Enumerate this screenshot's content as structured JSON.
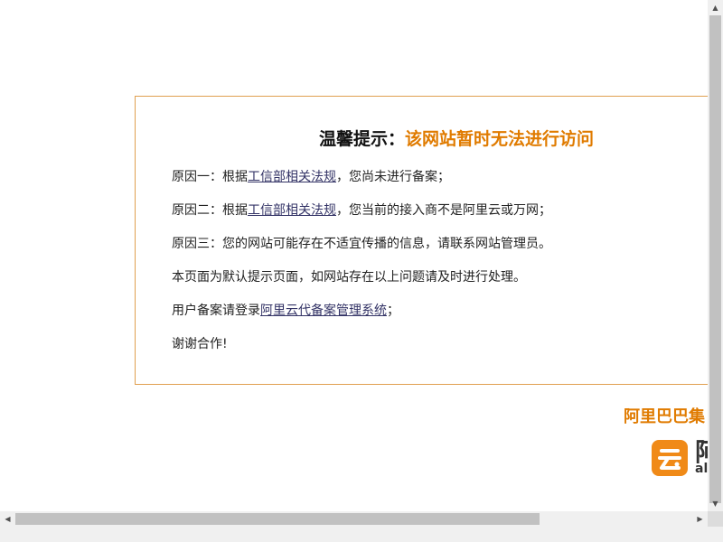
{
  "notice": {
    "title_prefix": "温馨提示：",
    "title_accent": "该网站暂时无法进行访问",
    "line1_before": "原因一：根据",
    "line1_link": "工信部相关法规",
    "line1_after": "，您尚未进行备案；",
    "line2_before": "原因二：根据",
    "line2_link": "工信部相关法规",
    "line2_after": "，您当前的接入商不是阿里云或万网；",
    "line3": "原因三：您的网站可能存在不适宜传播的信息，请联系网站管理员。",
    "line4": "本页面为默认提示页面，如网站存在以上问题请及时进行处理。",
    "line5_before": "用户备案请登录",
    "line5_link": "阿里云代备案管理系统",
    "line5_after": "；",
    "line6": "谢谢合作!"
  },
  "footer": {
    "group_name": "阿里巴巴集",
    "logo_cn": "阿",
    "logo_en": "al"
  },
  "scrollbars": {
    "up_arrow": "▲",
    "down_arrow": "▼",
    "left_arrow": "◀",
    "right_arrow": "▶"
  },
  "colors": {
    "accent": "#e07b00",
    "border": "#e0a050",
    "link": "#333366"
  },
  "icons": {
    "logo": "aliyun-logo-icon"
  }
}
